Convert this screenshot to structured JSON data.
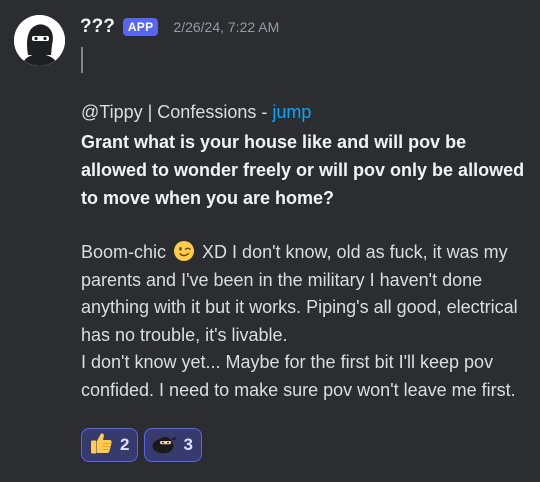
{
  "author": {
    "username": "???",
    "badge": "APP",
    "timestamp": "2/26/24, 7:22 AM",
    "avatar_icon": "ninja-avatar-icon"
  },
  "reply": {
    "prefix": "@Tippy | Confessions - ",
    "jump_label": "jump"
  },
  "question": "Grant what is your house like and will pov be allowed to wonder freely or will pov only be allowed to move when you are home?",
  "answer": {
    "part1": "Boom-chic",
    "emoji_icon": "winking-face-icon",
    "part2": " XD I don't know, old as fuck, it was my parents and I've been in the military I haven't done anything with it but it works. Piping's all good, electrical has no trouble, it's livable.",
    "part3": "I don't know yet... Maybe for the first bit I'll keep pov confided. I need to make sure pov won't leave me first."
  },
  "reactions": [
    {
      "icon": "thumbs-up-icon",
      "count": "2"
    },
    {
      "icon": "ninja-emoji-icon",
      "count": "3"
    }
  ],
  "colors": {
    "background": "#2b2d31",
    "badge": "#5865f2",
    "link": "#00a8fc",
    "reaction_bg": "#373a6c",
    "reaction_border": "#5865f2"
  }
}
